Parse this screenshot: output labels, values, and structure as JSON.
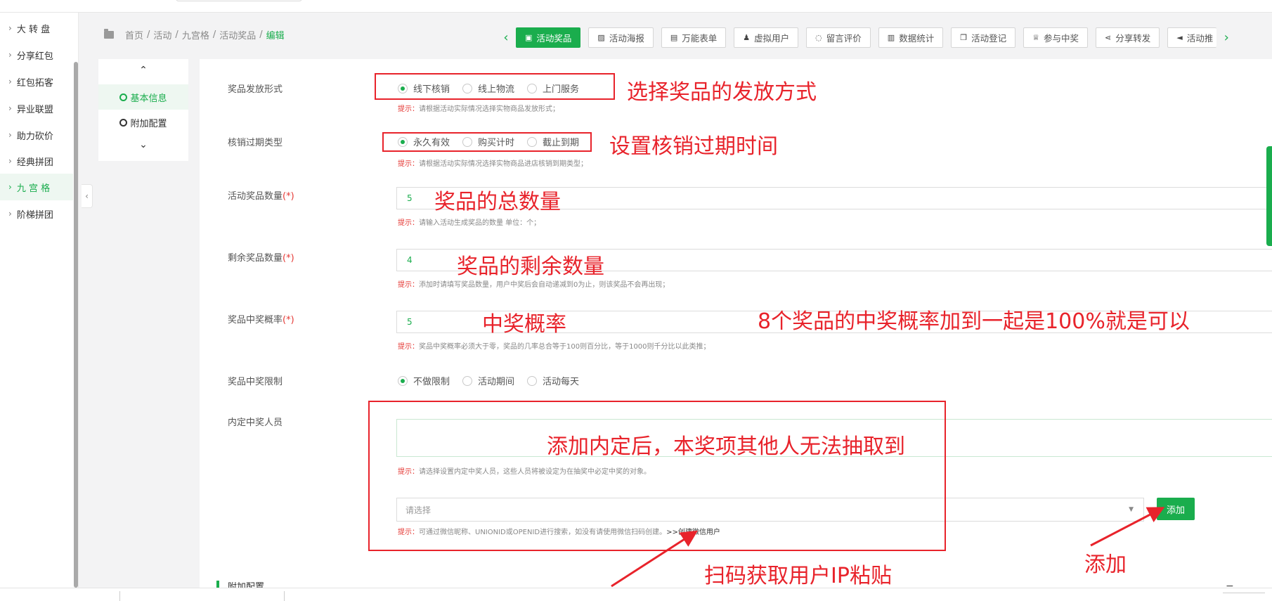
{
  "sidebar": {
    "items": [
      {
        "label": "大 转 盘"
      },
      {
        "label": "分享红包"
      },
      {
        "label": "红包拓客"
      },
      {
        "label": "异业联盟"
      },
      {
        "label": "助力砍价"
      },
      {
        "label": "经典拼团"
      },
      {
        "label": "九 宫 格",
        "active": true
      },
      {
        "label": "阶梯拼团"
      }
    ]
  },
  "breadcrumb": [
    "首页",
    "活动",
    "九宫格",
    "活动奖品",
    "编辑"
  ],
  "tabs": [
    {
      "label": "活动奖品",
      "icon": "gift-icon",
      "active": true
    },
    {
      "label": "活动海报",
      "icon": "image-icon"
    },
    {
      "label": "万能表单",
      "icon": "file-icon"
    },
    {
      "label": "虚拟用户",
      "icon": "user-plus-icon"
    },
    {
      "label": "留言评价",
      "icon": "comment-icon"
    },
    {
      "label": "数据统计",
      "icon": "bar-chart-icon"
    },
    {
      "label": "活动登记",
      "icon": "copy-icon"
    },
    {
      "label": "参与中奖",
      "icon": "trophy-icon"
    },
    {
      "label": "分享转发",
      "icon": "share-icon"
    },
    {
      "label": "活动推",
      "icon": "bullhorn-icon"
    }
  ],
  "innernav": {
    "items": [
      {
        "label": "基本信息",
        "active": true
      },
      {
        "label": "附加配置"
      }
    ]
  },
  "form": {
    "delivery": {
      "label": "奖品发放形式",
      "options": [
        "线下核销",
        "线上物流",
        "上门服务"
      ],
      "selected": 0,
      "hint_key": "提示：",
      "hint": "请根据活动实际情况选择实物商品发放形式；"
    },
    "expiry": {
      "label": "核销过期类型",
      "options": [
        "永久有效",
        "购买计时",
        "截止到期"
      ],
      "selected": 0,
      "hint_key": "提示：",
      "hint": "请根据活动实际情况选择实物商品进店核销到期类型；"
    },
    "total": {
      "label": "活动奖品数量",
      "req": "(*)",
      "value": "5",
      "hint_key": "提示：",
      "hint": "请输入活动生成奖品的数量 单位：个；"
    },
    "remaining": {
      "label": "剩余奖品数量",
      "req": "(*)",
      "value": "4",
      "hint_key": "提示：",
      "hint": "添加时请填写奖品数量，用户中奖后会自动递减到0为止，则该奖品不会再出现；"
    },
    "probability": {
      "label": "奖品中奖概率",
      "req": "(*)",
      "value": "5",
      "hint_key": "提示：",
      "hint": "奖品中奖概率必须大于零，奖品的几率总合等于100则百分比，等于1000则千分比以此类推；"
    },
    "limit": {
      "label": "奖品中奖限制",
      "options": [
        "不做限制",
        "活动期间",
        "活动每天"
      ],
      "selected": 0
    },
    "winners": {
      "label": "内定中奖人员",
      "hint_key": "提示：",
      "hint": "请选择设置内定中奖人员，这些人员将被设定为在抽奖中必定中奖的对象。",
      "select_placeholder": "请选择",
      "add_label": "添加",
      "search_hint_key": "提示：",
      "search_hint": "可通过微信昵称、UNIONID或OPENID进行搜索，如没有请使用微信扫码创建。",
      "create_link": ">>创建微信用户"
    },
    "extra_section_title": "附加配置"
  },
  "annotations": {
    "delivery": "选择奖品的发放方式",
    "expiry": "设置核销过期时间",
    "total": "奖品的总数量",
    "remaining": "奖品的剩余数量",
    "probability": "中奖概率",
    "probability_note": "8个奖品的中奖概率加到一起是100%就是可以",
    "winners": "添加内定后，本奖项其他人无法抽取到",
    "scan": "扫码获取用户IP粘贴",
    "add": "添加"
  },
  "colors": {
    "accent": "#1aad4d",
    "annotation": "#e8232b",
    "required": "#e53935"
  }
}
